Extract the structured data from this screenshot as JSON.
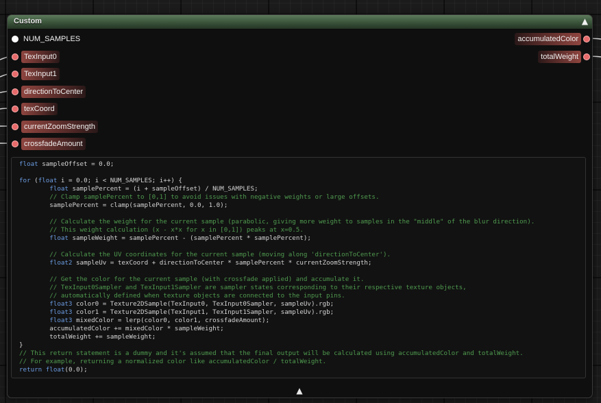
{
  "node": {
    "title": "Custom",
    "collapse_icon": "chevron-up-icon",
    "expand_icon": "chevron-up-icon"
  },
  "colors": {
    "header": "#3f5a3f",
    "pin": "#e76a6a",
    "exec_pin": "#ffffff",
    "comment": "#4f9a4f",
    "keyword": "#6b9be0"
  },
  "inputs": [
    {
      "label": "NUM_SAMPLES",
      "exec": true
    },
    {
      "label": "TexInput0"
    },
    {
      "label": "TexInput1"
    },
    {
      "label": "directionToCenter"
    },
    {
      "label": "texCoord"
    },
    {
      "label": "currentZoomStrength"
    },
    {
      "label": "crossfadeAmount"
    }
  ],
  "outputs": [
    {
      "label": "accumulatedColor"
    },
    {
      "label": "totalWeight"
    }
  ],
  "code_lines": [
    "float sampleOffset = 0.0;",
    "",
    "for (float i = 0.0; i < NUM_SAMPLES; i++) {",
    "        float samplePercent = (i + sampleOffset) / NUM_SAMPLES;",
    "        // Clamp samplePercent to [0,1] to avoid issues with negative weights or large offsets.",
    "        samplePercent = clamp(samplePercent, 0.0, 1.0);",
    "",
    "        // Calculate the weight for the current sample (parabolic, giving more weight to samples in the \"middle\" of the blur direction).",
    "        // This weight calculation (x - x*x for x in [0,1]) peaks at x=0.5.",
    "        float sampleWeight = samplePercent - (samplePercent * samplePercent);",
    "",
    "        // Calculate the UV coordinates for the current sample (moving along 'directionToCenter').",
    "        float2 sampleUv = texCoord + directionToCenter * samplePercent * currentZoomStrength;",
    "",
    "        // Get the color for the current sample (with crossfade applied) and accumulate it.",
    "        // TexInput0Sampler and TexInput1Sampler are sampler states corresponding to their respective texture objects,",
    "        // automatically defined when texture objects are connected to the input pins.",
    "        float3 color0 = Texture2DSample(TexInput0, TexInput0Sampler, sampleUv).rgb;",
    "        float3 color1 = Texture2DSample(TexInput1, TexInput1Sampler, sampleUv).rgb;",
    "        float3 mixedColor = lerp(color0, color1, crossfadeAmount);",
    "        accumulatedColor += mixedColor * sampleWeight;",
    "        totalWeight += sampleWeight;",
    "}",
    "// This return statement is a dummy and it's assumed that the final output will be calculated using accumulatedColor and totalWeight.",
    "// For example, returning a normalized color like accumulatedColor / totalWeight.",
    "return float(0.0);"
  ]
}
